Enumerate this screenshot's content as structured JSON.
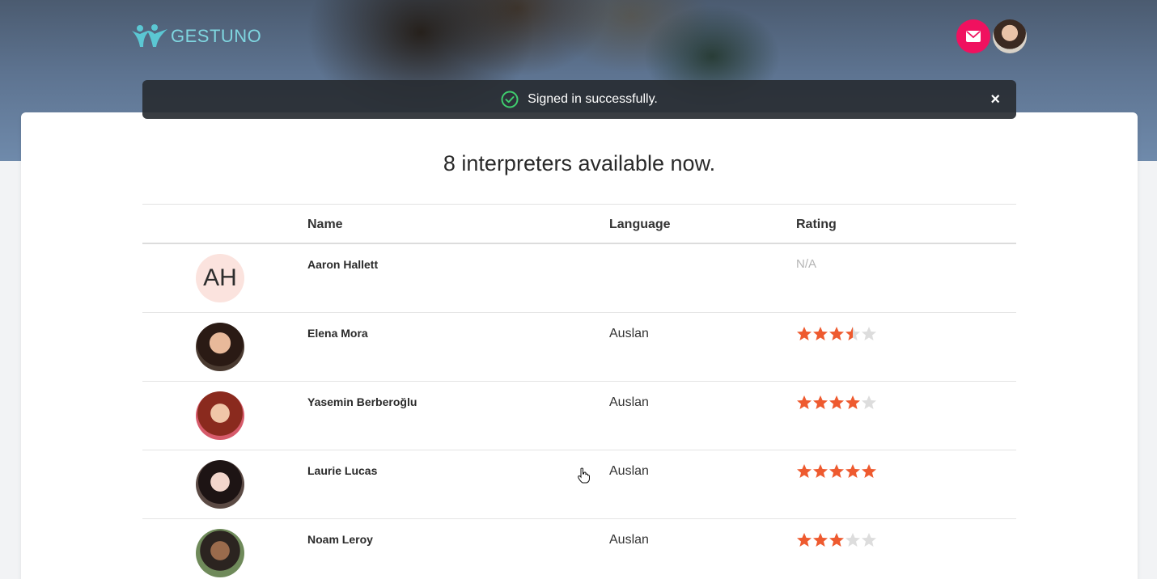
{
  "header": {
    "logo_text": "GESTUNO",
    "mail_icon": "mail-icon",
    "user_avatar": "user-avatar"
  },
  "toast": {
    "message": "Signed in successfully.",
    "icon": "check-circle-icon",
    "close_label": "×"
  },
  "main": {
    "heading": "8 interpreters available now."
  },
  "table": {
    "columns": [
      "",
      "Name",
      "Language",
      "Rating"
    ],
    "rows": [
      {
        "initials": "AH",
        "name": "Aaron Hallett",
        "language": "",
        "rating_text": "N/A",
        "rating": null
      },
      {
        "initials": "",
        "name": "Elena Mora",
        "language": "Auslan",
        "rating_text": "",
        "rating": 3.5
      },
      {
        "initials": "",
        "name": "Yasemin Berberoğlu",
        "language": "Auslan",
        "rating_text": "",
        "rating": 4
      },
      {
        "initials": "",
        "name": "Laurie Lucas",
        "language": "Auslan",
        "rating_text": "",
        "rating": 5
      },
      {
        "initials": "",
        "name": "Noam Leroy",
        "language": "Auslan",
        "rating_text": "",
        "rating": 3
      }
    ]
  },
  "colors": {
    "accent": "#f0115f",
    "star_filled": "#ee5a2f",
    "star_empty": "#dddddd",
    "logo": "#7fd6e0"
  }
}
